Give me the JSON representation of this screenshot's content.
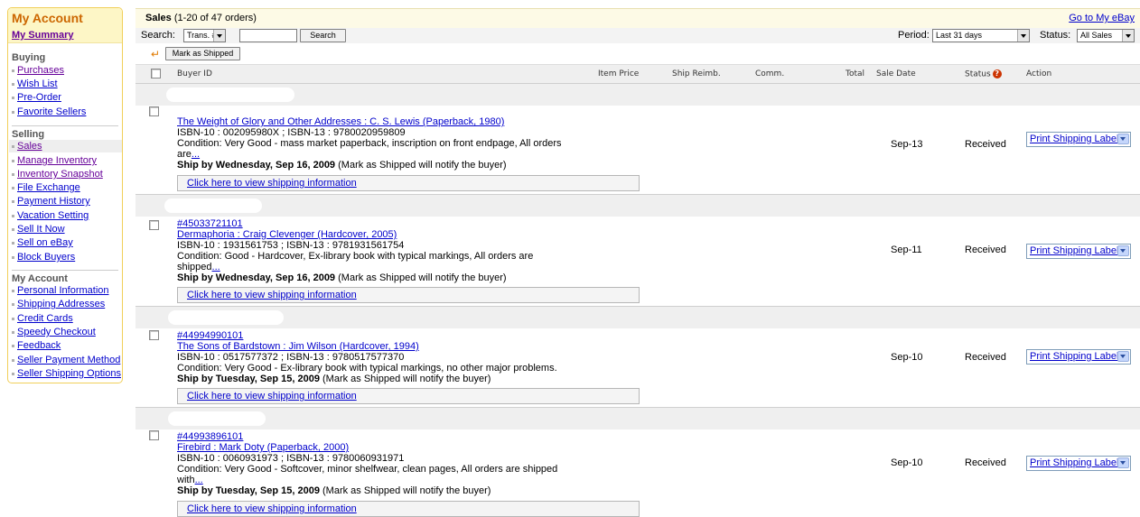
{
  "sidebar": {
    "title": "My Account",
    "summary": "My Summary",
    "buying_title": "Buying",
    "buying_items": [
      "Purchases",
      "Wish List",
      "Pre-Order",
      "Favorite Sellers"
    ],
    "selling_title": "Selling",
    "selling_items": [
      "Sales",
      "Manage Inventory",
      "Inventory Snapshot",
      "File Exchange",
      "Payment History",
      "Vacation Setting",
      "Sell It Now",
      "Sell on eBay",
      "Block Buyers"
    ],
    "account_title": "My Account",
    "account_items": [
      "Personal Information",
      "Shipping Addresses",
      "Credit Cards",
      "Speedy Checkout",
      "Feedback",
      "Seller Payment Method",
      "Seller Shipping Options"
    ]
  },
  "header": {
    "sales_label": "Sales",
    "sales_count": "(1-20 of 47 orders)",
    "goto_ebay": "Go to My eBay"
  },
  "search": {
    "label": "Search:",
    "type_value": "Trans. #",
    "input_value": "",
    "button": "Search",
    "period_label": "Period:",
    "period_value": "Last 31 days",
    "status_label": "Status:",
    "status_value": "All Sales"
  },
  "toolbar": {
    "mark_shipped": "Mark as Shipped"
  },
  "columns": {
    "buyer_id": "Buyer ID",
    "item_price": "Item Price",
    "ship_reimb": "Ship Reimb.",
    "comm": "Comm.",
    "total": "Total",
    "sale_date": "Sale Date",
    "status": "Status",
    "action": "Action"
  },
  "orders": [
    {
      "order_no": "",
      "title": "The Weight of Glory and Other Addresses : C. S. Lewis (Paperback, 1980)",
      "isbn": "ISBN-10 : 002095980X ; ISBN-13 : 9780020959809",
      "condition": "Condition: Very Good -  mass market paperback, inscription on front endpage, All orders",
      "condition_more": "are",
      "more": "...",
      "ship_by": "Ship by Wednesday, Sep 16, 2009",
      "ship_note": " (Mark as Shipped will notify the buyer)",
      "shipping_link": "Click here to view shipping information",
      "sale_date": "Sep-13",
      "status": "Received",
      "action": "Print Shipping Label"
    },
    {
      "order_no": "#45033721101",
      "title": "Dermaphoria : Craig Clevenger (Hardcover, 2005)",
      "isbn": "ISBN-10 : 1931561753 ; ISBN-13 : 9781931561754",
      "condition": "Condition: Good -  Hardcover, Ex-library book with typical markings, All orders are",
      "condition_more": "shipped",
      "more": "...",
      "ship_by": "Ship by Wednesday, Sep 16, 2009",
      "ship_note": " (Mark as Shipped will notify the buyer)",
      "shipping_link": "Click here to view shipping information",
      "sale_date": "Sep-11",
      "status": "Received",
      "action": "Print Shipping Label"
    },
    {
      "order_no": "#44994990101",
      "title": "The Sons of Bardstown : Jim Wilson (Hardcover, 1994)",
      "isbn": "ISBN-10 : 0517577372 ; ISBN-13 : 9780517577370",
      "condition": "Condition: Very Good - Ex-library book with typical markings, no other major problems.",
      "condition_more": "",
      "more": "",
      "ship_by": "Ship by Tuesday, Sep 15, 2009",
      "ship_note": " (Mark as Shipped will notify the buyer)",
      "shipping_link": "Click here to view shipping information",
      "sale_date": "Sep-10",
      "status": "Received",
      "action": "Print Shipping Label"
    },
    {
      "order_no": "#44993896101",
      "title": "Firebird : Mark Doty (Paperback, 2000)",
      "isbn": "ISBN-10 : 0060931973 ; ISBN-13 : 9780060931971",
      "condition": "Condition: Very Good -  Softcover, minor shelfwear, clean pages, All orders are shipped",
      "condition_more": "with",
      "more": "...",
      "ship_by": "Ship by Tuesday, Sep 15, 2009",
      "ship_note": " (Mark as Shipped will notify the buyer)",
      "shipping_link": "Click here to view shipping information",
      "sale_date": "Sep-10",
      "status": "Received",
      "action": "Print Shipping Label"
    }
  ]
}
